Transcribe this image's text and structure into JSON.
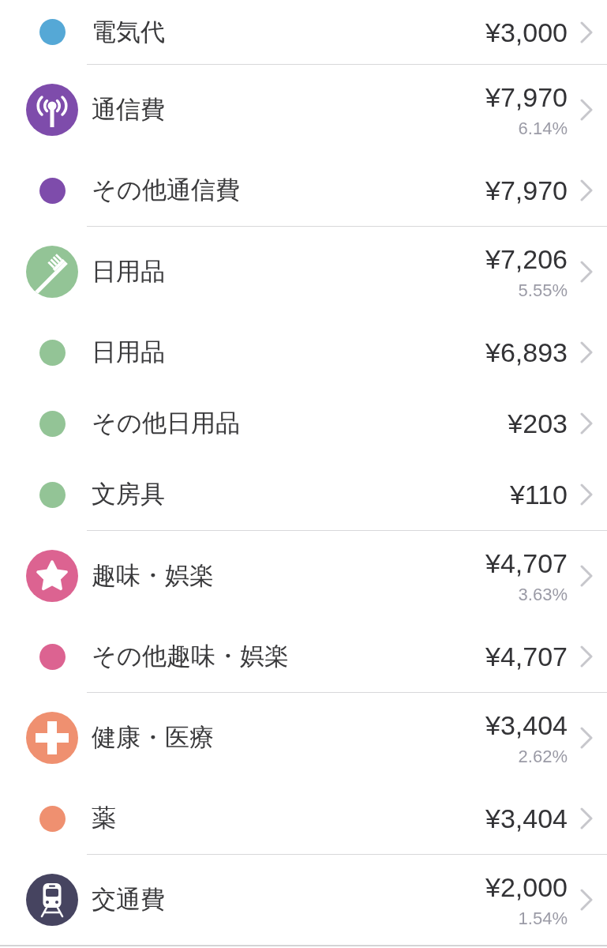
{
  "rows": [
    {
      "kind": "subcategory",
      "label": "電気代",
      "amount": "¥3,000",
      "color": "#55a8d6"
    },
    {
      "kind": "category",
      "label": "通信費",
      "amount": "¥7,970",
      "share": "6.14%",
      "color": "#7e4cab"
    },
    {
      "kind": "subcategory",
      "label": "その他通信費",
      "amount": "¥7,970",
      "color": "#7e4cab"
    },
    {
      "kind": "category",
      "label": "日用品",
      "amount": "¥7,206",
      "share": "5.55%",
      "color": "#93c496"
    },
    {
      "kind": "subcategory",
      "label": "日用品",
      "amount": "¥6,893",
      "color": "#93c496"
    },
    {
      "kind": "subcategory",
      "label": "その他日用品",
      "amount": "¥203",
      "color": "#93c496"
    },
    {
      "kind": "subcategory",
      "label": "文房具",
      "amount": "¥110",
      "color": "#93c496"
    },
    {
      "kind": "category",
      "label": "趣味・娯楽",
      "amount": "¥4,707",
      "share": "3.63%",
      "color": "#dc6391"
    },
    {
      "kind": "subcategory",
      "label": "その他趣味・娯楽",
      "amount": "¥4,707",
      "color": "#dc6391"
    },
    {
      "kind": "category",
      "label": "健康・医療",
      "amount": "¥3,404",
      "share": "2.62%",
      "color": "#ef9070"
    },
    {
      "kind": "subcategory",
      "label": "薬",
      "amount": "¥3,404",
      "color": "#ef9070"
    },
    {
      "kind": "category",
      "label": "交通費",
      "amount": "¥2,000",
      "share": "1.54%",
      "color": "#464460"
    }
  ]
}
